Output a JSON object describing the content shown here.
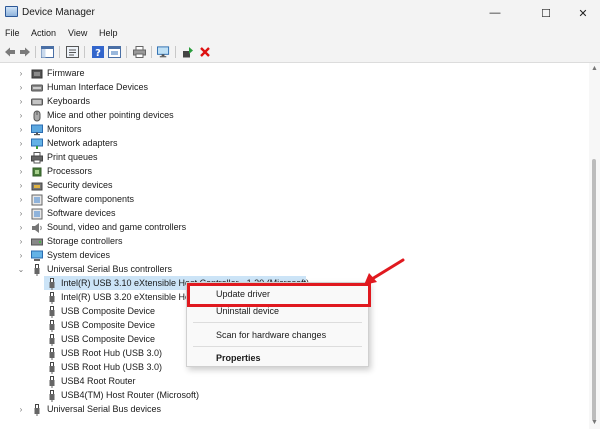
{
  "window": {
    "title": "Device Manager",
    "minimize": "—",
    "maximize": "☐",
    "close": "✕"
  },
  "menu": [
    "File",
    "Action",
    "View",
    "Help"
  ],
  "tree": [
    {
      "label": "Firmware",
      "icon": "firmware-icon"
    },
    {
      "label": "Human Interface Devices",
      "icon": "hid-icon"
    },
    {
      "label": "Keyboards",
      "icon": "keyboard-icon"
    },
    {
      "label": "Mice and other pointing devices",
      "icon": "mouse-icon"
    },
    {
      "label": "Monitors",
      "icon": "monitor-icon"
    },
    {
      "label": "Network adapters",
      "icon": "network-icon"
    },
    {
      "label": "Print queues",
      "icon": "printer-icon"
    },
    {
      "label": "Processors",
      "icon": "processor-icon"
    },
    {
      "label": "Security devices",
      "icon": "security-icon"
    },
    {
      "label": "Software components",
      "icon": "software-icon"
    },
    {
      "label": "Software devices",
      "icon": "software-icon"
    },
    {
      "label": "Sound, video and game controllers",
      "icon": "sound-icon"
    },
    {
      "label": "Storage controllers",
      "icon": "storage-icon"
    },
    {
      "label": "System devices",
      "icon": "system-icon"
    },
    {
      "label": "Universal Serial Bus controllers",
      "icon": "usb-icon"
    },
    {
      "label": "Intel(R) USB 3.10 eXtensible Host Controller - 1.20 (Microsoft)",
      "icon": "usb-icon"
    },
    {
      "label": "Intel(R) USB 3.20 eXtensible Host Controller - 1.20 (Microsoft)",
      "icon": "usb-icon"
    },
    {
      "label": "USB Composite Device",
      "icon": "usb-icon"
    },
    {
      "label": "USB Composite Device",
      "icon": "usb-icon"
    },
    {
      "label": "USB Composite Device",
      "icon": "usb-icon"
    },
    {
      "label": "USB Root Hub (USB 3.0)",
      "icon": "usb-icon"
    },
    {
      "label": "USB Root Hub (USB 3.0)",
      "icon": "usb-icon"
    },
    {
      "label": "USB4 Root Router",
      "icon": "usb-icon"
    },
    {
      "label": "USB4(TM) Host Router (Microsoft)",
      "icon": "usb-icon"
    },
    {
      "label": "Universal Serial Bus devices",
      "icon": "usb-icon"
    }
  ],
  "context_menu": {
    "update": "Update driver",
    "uninstall": "Uninstall device",
    "scan": "Scan for hardware changes",
    "properties": "Properties"
  },
  "colors": {
    "selection": "#cce4f7",
    "highlight": "#e0191f"
  }
}
